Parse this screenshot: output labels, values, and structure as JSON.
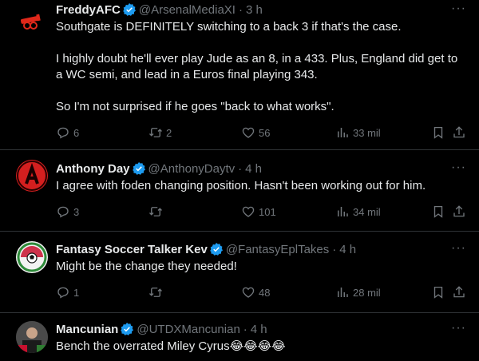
{
  "tweets": [
    {
      "name": "FreddyAFC",
      "handle": "@ArsenalMediaXI",
      "sep": "·",
      "time": "3 h",
      "text": "Southgate is DEFINITELY switching to a back 3 if that's the case.\n\nI highly doubt he'll ever play Jude as an 8, in a 433. Plus, England did get to a WC semi, and lead in a Euros final playing 343.\n\nSo I'm not surprised if he goes \"back to what works\".",
      "replies": "6",
      "reposts": "2",
      "likes": "56",
      "views": "33 mil",
      "avatar_icon": "cannon-icon"
    },
    {
      "name": "Anthony Day",
      "handle": "@AnthonyDaytv",
      "sep": "·",
      "time": "4 h",
      "text": "I agree with foden changing position. Hasn't been  working out for him.",
      "replies": "3",
      "reposts": "",
      "likes": "101",
      "views": "34 mil",
      "avatar_icon": "letter-a-logo"
    },
    {
      "name": "Fantasy Soccer Talker Kev",
      "handle": "@FantasyEplTakes",
      "sep": "·",
      "time": "4 h",
      "text": "Might be the change they needed!",
      "replies": "1",
      "reposts": "",
      "likes": "48",
      "views": "28 mil",
      "avatar_icon": "soccer-ball-logo"
    },
    {
      "name": "Mancunian",
      "handle": "@UTDXMancunian",
      "sep": "·",
      "time": "4 h",
      "text": "Bench the overrated Miley Cyrus😂😂😂😂",
      "avatar_icon": "photo-avatar"
    }
  ],
  "colors": {
    "background": "#000000",
    "text": "#e7e9ea",
    "muted": "#71767b",
    "verified": "#1d9bf0",
    "divider": "#2f3336"
  },
  "more_label": "···"
}
